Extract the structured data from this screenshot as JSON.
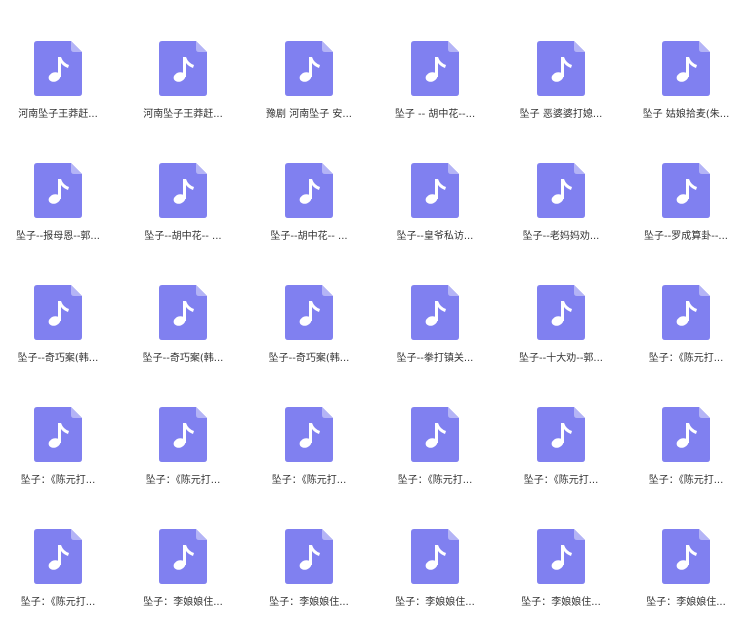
{
  "colors": {
    "icon_body": "#8080f0",
    "icon_fold": "#b4b4f6",
    "glyph": "#ffffff",
    "label_text": "#333333"
  },
  "file_icon": "music-note-file-icon",
  "files": [
    {
      "label": "河南坠子王莽赶..."
    },
    {
      "label": "河南坠子王莽赶..."
    },
    {
      "label": "豫剧 河南坠子 安..."
    },
    {
      "label": "坠子 -- 胡中花--..."
    },
    {
      "label": "坠子 恶婆婆打媳..."
    },
    {
      "label": "坠子 姑娘拾麦(朱..."
    },
    {
      "label": "坠子--报母恩--郭..."
    },
    {
      "label": "坠子--胡中花-- ..."
    },
    {
      "label": "坠子--胡中花-- ..."
    },
    {
      "label": "坠子--皇爷私访..."
    },
    {
      "label": "坠子--老妈妈劝..."
    },
    {
      "label": "坠子--罗成算卦--..."
    },
    {
      "label": "坠子--奇巧案(韩..."
    },
    {
      "label": "坠子--奇巧案(韩..."
    },
    {
      "label": "坠子--奇巧案(韩..."
    },
    {
      "label": "坠子--拳打镇关..."
    },
    {
      "label": "坠子--十大劝--郭..."
    },
    {
      "label": "坠子：《陈元打..."
    },
    {
      "label": "坠子：《陈元打..."
    },
    {
      "label": "坠子：《陈元打..."
    },
    {
      "label": "坠子：《陈元打..."
    },
    {
      "label": "坠子：《陈元打..."
    },
    {
      "label": "坠子：《陈元打..."
    },
    {
      "label": "坠子：《陈元打..."
    },
    {
      "label": "坠子：《陈元打..."
    },
    {
      "label": "坠子：李娘娘住..."
    },
    {
      "label": "坠子：李娘娘住..."
    },
    {
      "label": "坠子：李娘娘住..."
    },
    {
      "label": "坠子：李娘娘住..."
    },
    {
      "label": "坠子：李娘娘住..."
    }
  ]
}
